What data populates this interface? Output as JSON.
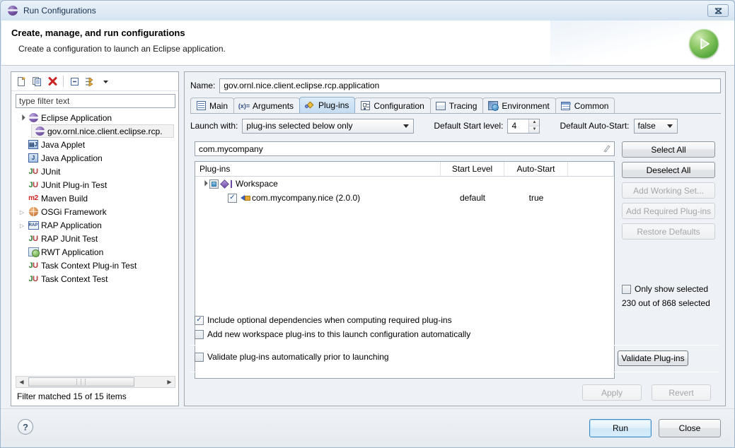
{
  "window": {
    "title": "Run Configurations",
    "title_icon": "eclipse-icon",
    "close_label": "⌧"
  },
  "header": {
    "title": "Create, manage, and run configurations",
    "subtitle": "Create a configuration to launch an Eclipse application.",
    "badge_icon": "run-play-icon"
  },
  "left_panel": {
    "toolbar": [
      {
        "name": "new-launch-configuration-icon",
        "label": ""
      },
      {
        "name": "duplicate-launch-configuration-icon",
        "label": ""
      },
      {
        "name": "delete-launch-configuration-icon",
        "label": ""
      },
      {
        "name": "collapse-all-icon",
        "label": ""
      },
      {
        "name": "filter-launch-configurations-icon",
        "label": ""
      },
      {
        "name": "view-menu-chevron-icon",
        "label": ""
      }
    ],
    "filter": {
      "placeholder": "type filter text",
      "value": "type filter text"
    },
    "tree": [
      {
        "label": "Eclipse Application",
        "icon": "eclipse-icon",
        "twisty": "open",
        "depth": 0,
        "selected": false
      },
      {
        "label": "gov.ornl.nice.client.eclipse.rcp.",
        "icon": "eclipse-icon",
        "twisty": "none",
        "depth": 1,
        "selected": true
      },
      {
        "label": "Java Applet",
        "icon": "java-applet-icon",
        "twisty": "none",
        "depth": 0,
        "selected": false
      },
      {
        "label": "Java Application",
        "icon": "java-application-icon",
        "twisty": "none",
        "depth": 0,
        "selected": false
      },
      {
        "label": "JUnit",
        "icon": "junit-icon",
        "twisty": "none",
        "depth": 0,
        "selected": false
      },
      {
        "label": "JUnit Plug-in Test",
        "icon": "junit-plugin-test-icon",
        "twisty": "none",
        "depth": 0,
        "selected": false
      },
      {
        "label": "Maven Build",
        "icon": "maven-icon",
        "twisty": "none",
        "depth": 0,
        "selected": false
      },
      {
        "label": "OSGi Framework",
        "icon": "osgi-icon",
        "twisty": "closed",
        "depth": 0,
        "selected": false
      },
      {
        "label": "RAP Application",
        "icon": "rap-icon",
        "twisty": "closed",
        "depth": 0,
        "selected": false
      },
      {
        "label": "RAP JUnit Test",
        "icon": "junit-icon",
        "twisty": "none",
        "depth": 0,
        "selected": false
      },
      {
        "label": "RWT Application",
        "icon": "rwt-icon",
        "twisty": "none",
        "depth": 0,
        "selected": false
      },
      {
        "label": "Task Context Plug-in Test",
        "icon": "junit-plugin-test-icon",
        "twisty": "none",
        "depth": 0,
        "selected": false
      },
      {
        "label": "Task Context Test",
        "icon": "junit-icon",
        "twisty": "none",
        "depth": 0,
        "selected": false
      }
    ],
    "scrollbar": {
      "left_arrow": "◀",
      "right_arrow": "▶",
      "grip": "❘❘❘"
    },
    "status": "Filter matched 15 of 15 items"
  },
  "right_panel": {
    "name_label": "Name:",
    "name_value": "gov.ornl.nice.client.eclipse.rcp.application",
    "tabs": [
      {
        "label": "Main",
        "icon": "main-tab-icon",
        "active": false
      },
      {
        "label": "Arguments",
        "icon": "arguments-tab-icon",
        "active": false
      },
      {
        "label": "Plug-ins",
        "icon": "plugins-tab-icon",
        "active": true
      },
      {
        "label": "Configuration",
        "icon": "configuration-tab-icon",
        "active": false
      },
      {
        "label": "Tracing",
        "icon": "tracing-tab-icon",
        "active": false
      },
      {
        "label": "Environment",
        "icon": "environment-tab-icon",
        "active": false
      },
      {
        "label": "Common",
        "icon": "common-tab-icon",
        "active": false
      }
    ],
    "launch_with_label": "Launch with:",
    "launch_with_value": "plug-ins selected below only",
    "default_start_level_label": "Default Start level:",
    "default_start_level_value": "4",
    "default_auto_start_label": "Default Auto-Start:",
    "default_auto_start_value": "false",
    "plugin_filter_value": "com.mycompany",
    "plugin_filter_clear_icon": "clear-icon",
    "table": {
      "columns": [
        "Plug-ins",
        "Start Level",
        "Auto-Start"
      ],
      "rows": [
        {
          "type": "group",
          "label": "Workspace",
          "icon": "workspace-icon",
          "twisty": "open",
          "checkbox": "partial",
          "start_level": "",
          "auto_start": ""
        },
        {
          "type": "plugin",
          "label": "com.mycompany.nice (2.0.0)",
          "icon": "plugin-icon",
          "twisty": "none",
          "checkbox": "checked",
          "start_level": "default",
          "auto_start": "true"
        }
      ]
    },
    "side_buttons": [
      {
        "label": "Select All",
        "enabled": true
      },
      {
        "label": "Deselect All",
        "enabled": true
      },
      {
        "label": "Add Working Set...",
        "enabled": false
      },
      {
        "label": "Add Required Plug-ins",
        "enabled": false
      },
      {
        "label": "Restore Defaults",
        "enabled": false
      }
    ],
    "only_show_selected": {
      "label": "Only show selected",
      "checked": false
    },
    "selection_count": "230 out of 868 selected",
    "options": [
      {
        "label": "Include optional dependencies when computing required plug-ins",
        "checked": true
      },
      {
        "label": "Add new workspace plug-ins to this launch configuration automatically",
        "checked": false
      }
    ],
    "validate_option": {
      "label": "Validate plug-ins automatically prior to launching",
      "checked": false
    },
    "validate_button": "Validate Plug-ins",
    "apply_button": "Apply",
    "revert_button": "Revert"
  },
  "footer": {
    "help_label": "?",
    "run_button": "Run",
    "close_button": "Close"
  }
}
